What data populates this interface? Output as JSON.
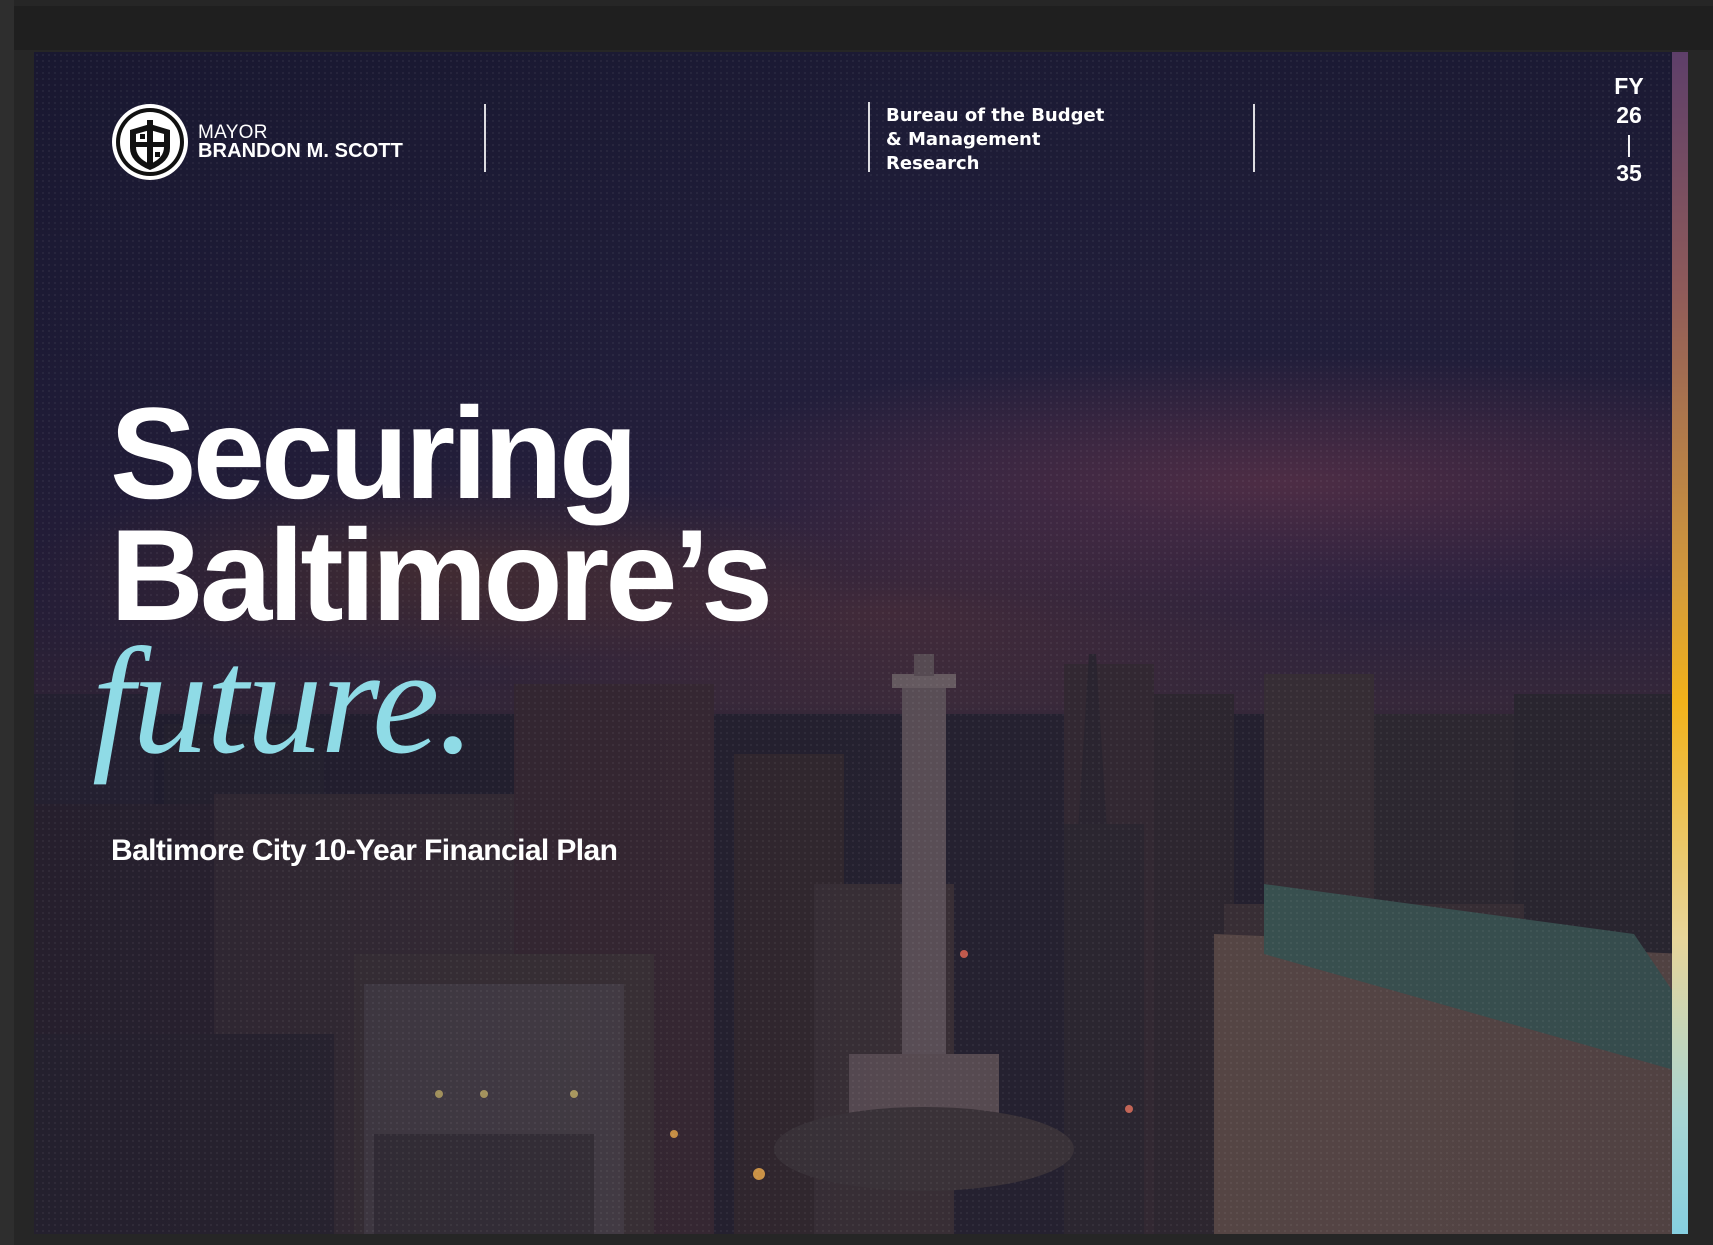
{
  "header": {
    "mayor_title": "MAYOR",
    "mayor_name": "BRANDON M. SCOTT",
    "bureau_lines": [
      "Bureau of the Budget",
      "& Management",
      "Research"
    ],
    "fy_label": "FY",
    "fy_start": "26",
    "fy_separator": "|",
    "fy_end": "35"
  },
  "title": {
    "line1": "Securing",
    "line2": "Baltimore’s",
    "line3": "future."
  },
  "subtitle": "Baltimore City 10-Year Financial Plan",
  "colors": {
    "accent_teal": "#8fdbe6",
    "accent_gold": "#f2b21a",
    "background_night": "#1b1a33",
    "text": "#ffffff"
  },
  "icons": {
    "seal": "city-seal-icon"
  }
}
